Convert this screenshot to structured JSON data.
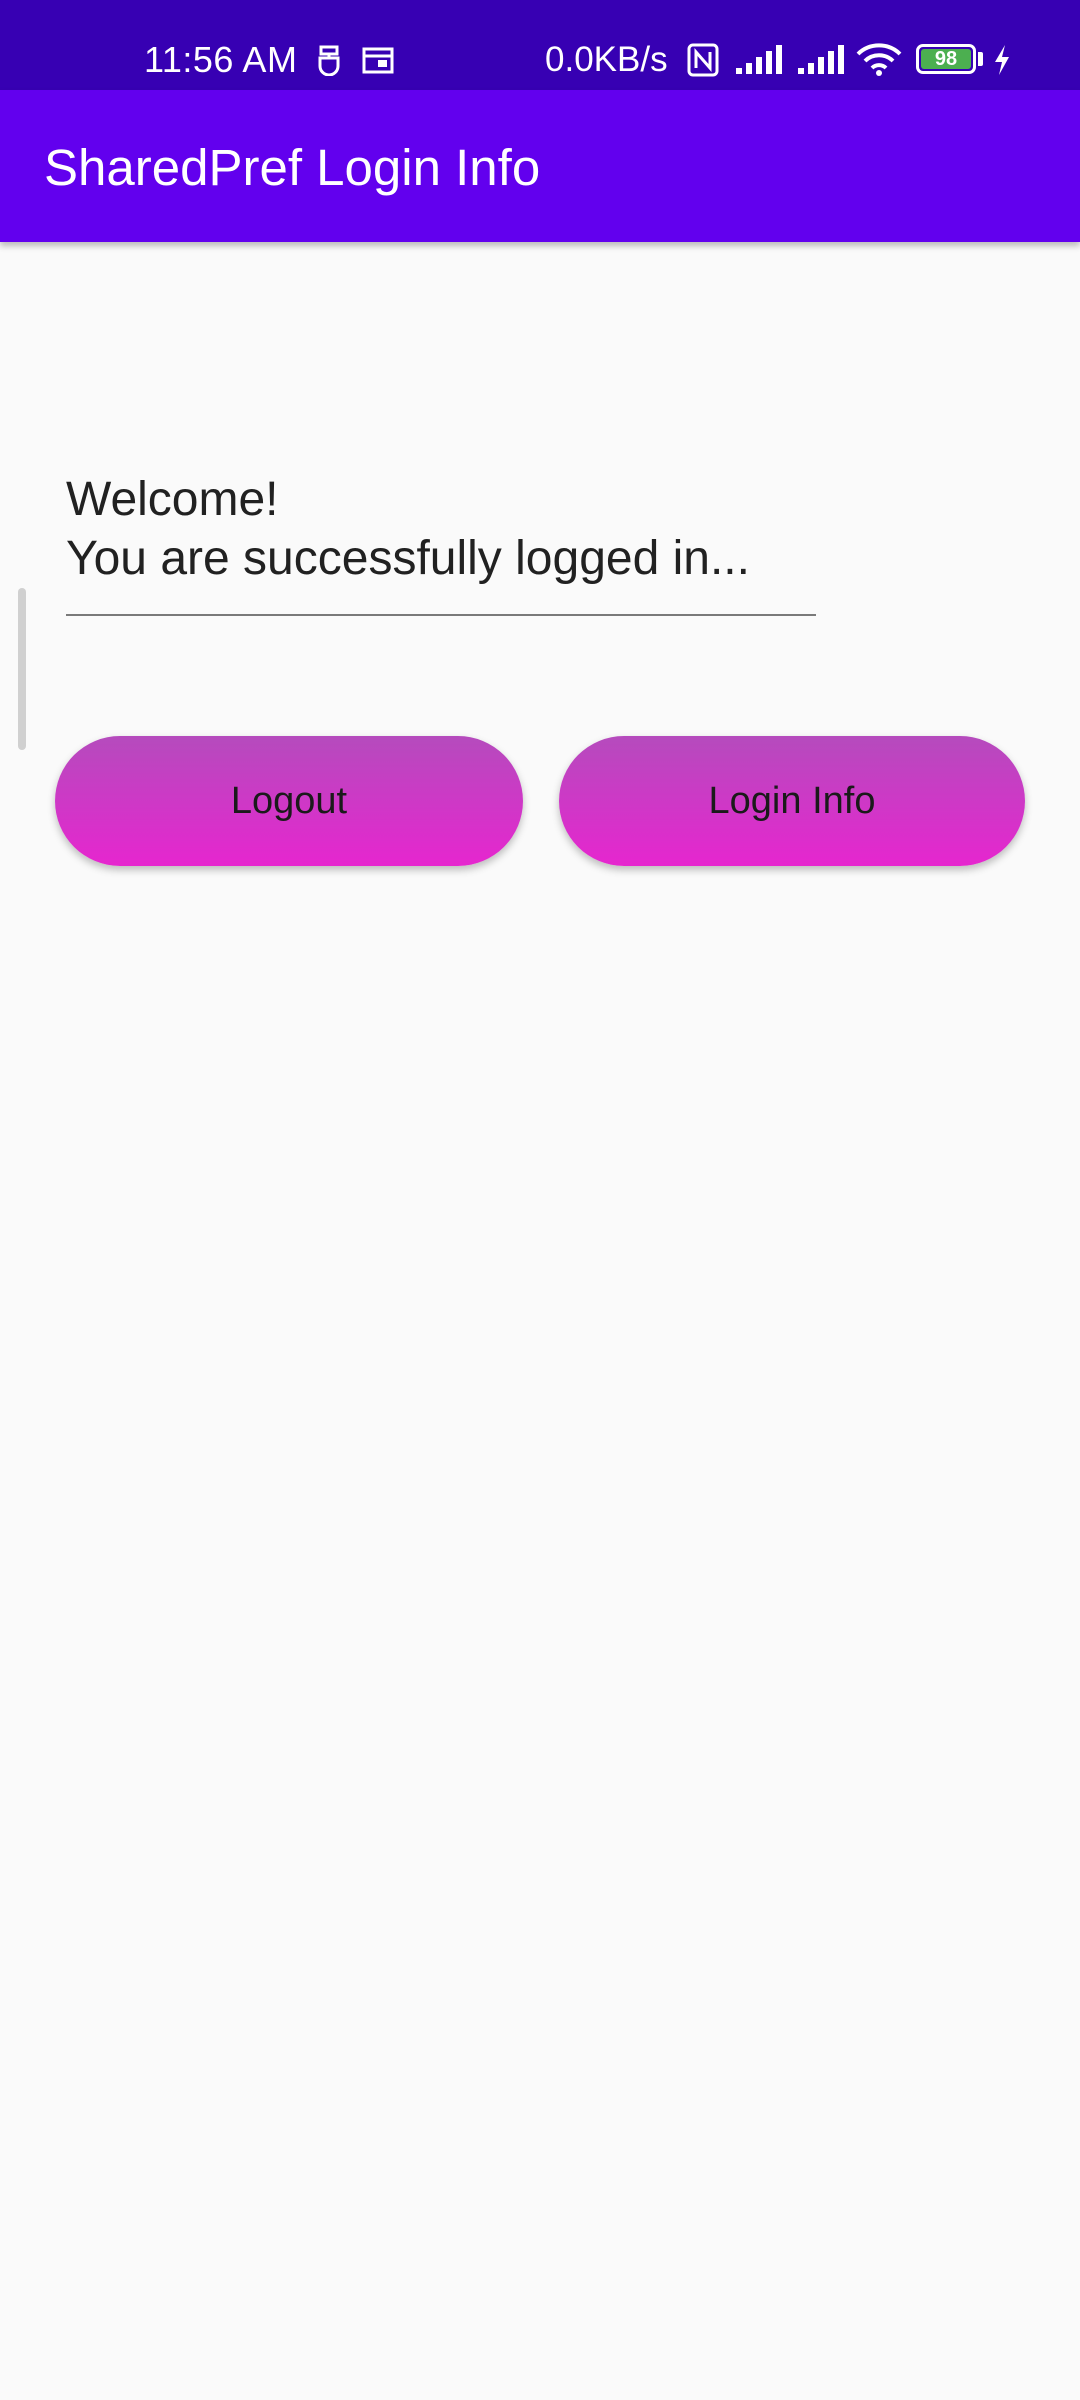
{
  "status_bar": {
    "time": "11:56 AM",
    "network_speed": "0.0KB/s",
    "battery_level": "98",
    "icons": [
      "vpn-key-icon",
      "calendar-icon",
      "nfc-icon",
      "signal-icon",
      "signal-icon",
      "wifi-icon",
      "battery-icon",
      "charging-icon"
    ],
    "background_color": "#3700b3"
  },
  "app_bar": {
    "title": "SharedPref Login Info",
    "background_color": "#6200ee"
  },
  "welcome": {
    "line1": "Welcome!",
    "line2": "You are successfully logged in..."
  },
  "buttons": {
    "logout_label": "Logout",
    "login_info_label": "Login Info",
    "gradient_top": "#b54bbd",
    "gradient_bottom": "#e626cf"
  }
}
